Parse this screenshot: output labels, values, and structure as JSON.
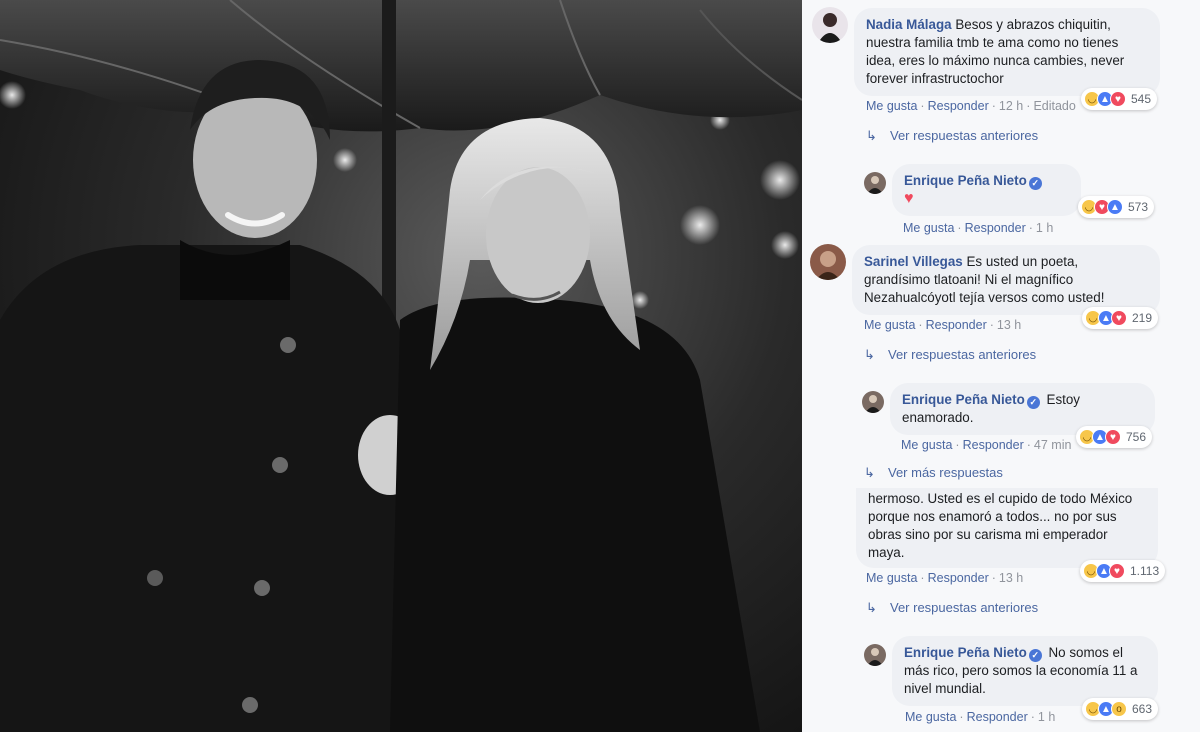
{
  "comments": [
    {
      "author": "Nadia Málaga",
      "text": "Besos y abrazos chiquitin, nuestra familia tmb te ama como no tienes idea, eres lo máximo nunca cambies, never forever infrastructochor",
      "like": "Me gusta",
      "reply": "Responder",
      "time": "12 h",
      "edited": "Editado",
      "reactions": "545"
    },
    {
      "more": "Ver respuestas anteriores"
    },
    {
      "author": "Enrique Peña Nieto",
      "text": "♥",
      "like": "Me gusta",
      "reply": "Responder",
      "time": "1 h",
      "reactions": "573"
    },
    {
      "author": "Sarinel Villegas",
      "text": "Es usted un poeta, grandísimo tlatoani! Ni el magnífico Nezahualcóyotl tejía versos como usted!",
      "like": "Me gusta",
      "reply": "Responder",
      "time": "13 h",
      "reactions": "219"
    },
    {
      "more": "Ver respuestas anteriores"
    },
    {
      "author": "Enrique Peña Nieto",
      "text": "Estoy enamorado.",
      "like": "Me gusta",
      "reply": "Responder",
      "time": "47 min",
      "reactions": "756"
    },
    {
      "more": "Ver más respuestas"
    },
    {
      "text": "hermoso. Usted es el cupido de todo México porque nos enamoró a todos... no por sus obras sino por su carisma mi emperador maya.",
      "like": "Me gusta",
      "reply": "Responder",
      "time": "13 h",
      "reactions": "1.113"
    },
    {
      "more": "Ver respuestas anteriores"
    },
    {
      "author": "Enrique Peña Nieto",
      "text": "No somos el más rico, pero somos la economía 11 a nivel mundial.",
      "like": "Me gusta",
      "reply": "Responder",
      "time": "1 h",
      "reactions": "663"
    }
  ],
  "colors": {
    "link": "#385898",
    "bubble": "#eef0f4",
    "panel": "#f7f8fa"
  }
}
